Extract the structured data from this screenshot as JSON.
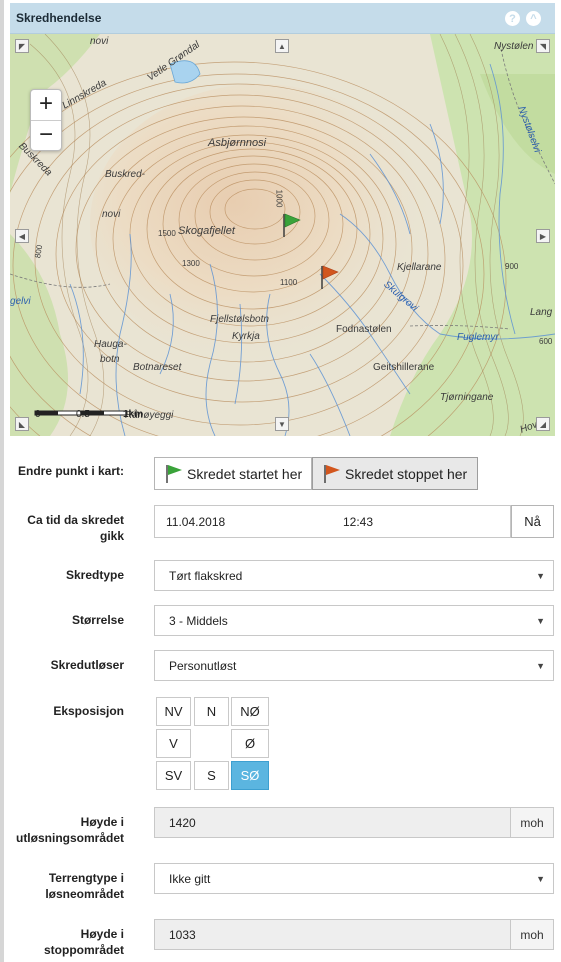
{
  "panel": {
    "title": "Skredhendelse",
    "help_icon": "question-circle-icon",
    "collapse_icon": "chevron-up-icon"
  },
  "map": {
    "zoom_in": "+",
    "zoom_out": "−",
    "labels": {
      "novi": "novi",
      "vetle_grondal": "Vetle Grøndal",
      "linnskreda": "Linnskreda",
      "buskreda_left": "Buskreda",
      "buskreda": "Buskred-",
      "novi2": "novi",
      "asbjornnosi": "Asbjørnnosi",
      "skogafjellet": "Skogafjellet",
      "fjellstolsbotn": "Fjellstølsbotn",
      "kyrkja": "Kyrkja",
      "haugabotn1": "Hauga-",
      "haugabotn2": "botn",
      "botnareset": "Botnareset",
      "ranoyeggi": "Rånøyeggi",
      "nystolen": "Nystølen",
      "nystolselvi": "Nystølselvi",
      "kjellarane": "Kjellarane",
      "skulgrovi": "Skulgrovi",
      "fodnastolen": "Fodnastølen",
      "fuglemyr": "Fuglemyr",
      "geitshillerane": "Geitshillerane",
      "tjorningane": "Tjørningane",
      "lang": "Lang",
      "hov": "Hov",
      "gelvi": "gelvi",
      "c1500": "1500",
      "c1300": "1300",
      "c1100": "1100",
      "c1000": "1000",
      "c800": "800",
      "c900": "900",
      "c600": "600"
    },
    "scale": {
      "zero": "0",
      "half": "0.5",
      "one": "1km"
    }
  },
  "form": {
    "endre_punkt_label": "Endre punkt i kart:",
    "start_button": "Skredet startet her",
    "stop_button": "Skredet stoppet her",
    "tid_label": "Ca tid da skredet gikk",
    "date": "11.04.2018",
    "time": "12:43",
    "na_button": "Nå",
    "skredtype_label": "Skredtype",
    "skredtype_value": "Tørt flakskred",
    "storrelse_label": "Størrelse",
    "storrelse_value": "3 - Middels",
    "skredutloser_label": "Skredutløser",
    "skredutloser_value": "Personutløst",
    "eksposisjon_label": "Eksposisjon",
    "directions": {
      "nv": "NV",
      "n": "N",
      "no": "NØ",
      "v": "V",
      "o": "Ø",
      "sv": "SV",
      "s": "S",
      "so": "SØ"
    },
    "selected_direction": "SØ",
    "hoyde_utlosning_label": "Høyde i utløsningsområdet",
    "hoyde_utlosning_value": "1420",
    "unit": "moh",
    "terrengtype_label": "Terrengtype i løsneområdet",
    "terrengtype_value": "Ikke gitt",
    "hoyde_stopp_label": "Høyde i stoppområdet",
    "hoyde_stopp_value": "1033"
  },
  "colors": {
    "header": "#c5dcea",
    "selected": "#5bb5e0",
    "flag_start": "#3aa33a",
    "flag_stop": "#d2561e"
  }
}
